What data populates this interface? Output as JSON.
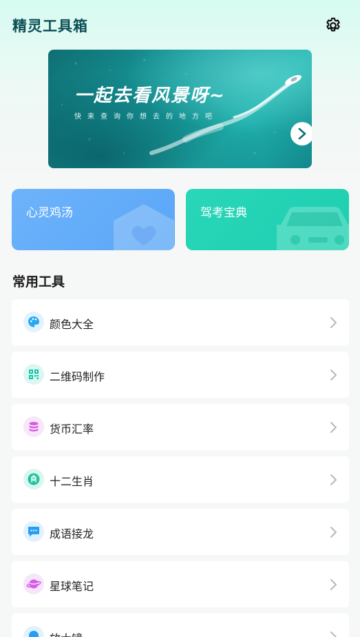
{
  "header": {
    "title": "精灵工具箱",
    "settings_icon": "gear-icon"
  },
  "banner": {
    "title": "一起去看风景呀~",
    "subtitle": "快来查询你想去的地方吧",
    "next_icon": "chevron-right-icon"
  },
  "cards": {
    "soup": {
      "label": "心灵鸡汤",
      "icon": "heart-house-icon",
      "color": "#62acf9"
    },
    "drive": {
      "label": "驾考宝典",
      "icon": "car-icon",
      "color": "#25d3b4"
    }
  },
  "tools": {
    "section_title": "常用工具",
    "items": [
      {
        "label": "颜色大全",
        "icon": "palette-icon",
        "color": "#29a8f2"
      },
      {
        "label": "二维码制作",
        "icon": "qrcode-icon",
        "color": "#15c3a6"
      },
      {
        "label": "货币汇率",
        "icon": "coins-icon",
        "color": "#d85be0"
      },
      {
        "label": "十二生肖",
        "icon": "zodiac-icon",
        "color": "#1fc49f"
      },
      {
        "label": "成语接龙",
        "icon": "chat-bubble-icon",
        "color": "#279ef3"
      },
      {
        "label": "星球笔记",
        "icon": "planet-icon",
        "color": "#d65ee6"
      },
      {
        "label": "放大镜",
        "icon": "magnifier-icon",
        "color": "#279ef3"
      }
    ]
  }
}
